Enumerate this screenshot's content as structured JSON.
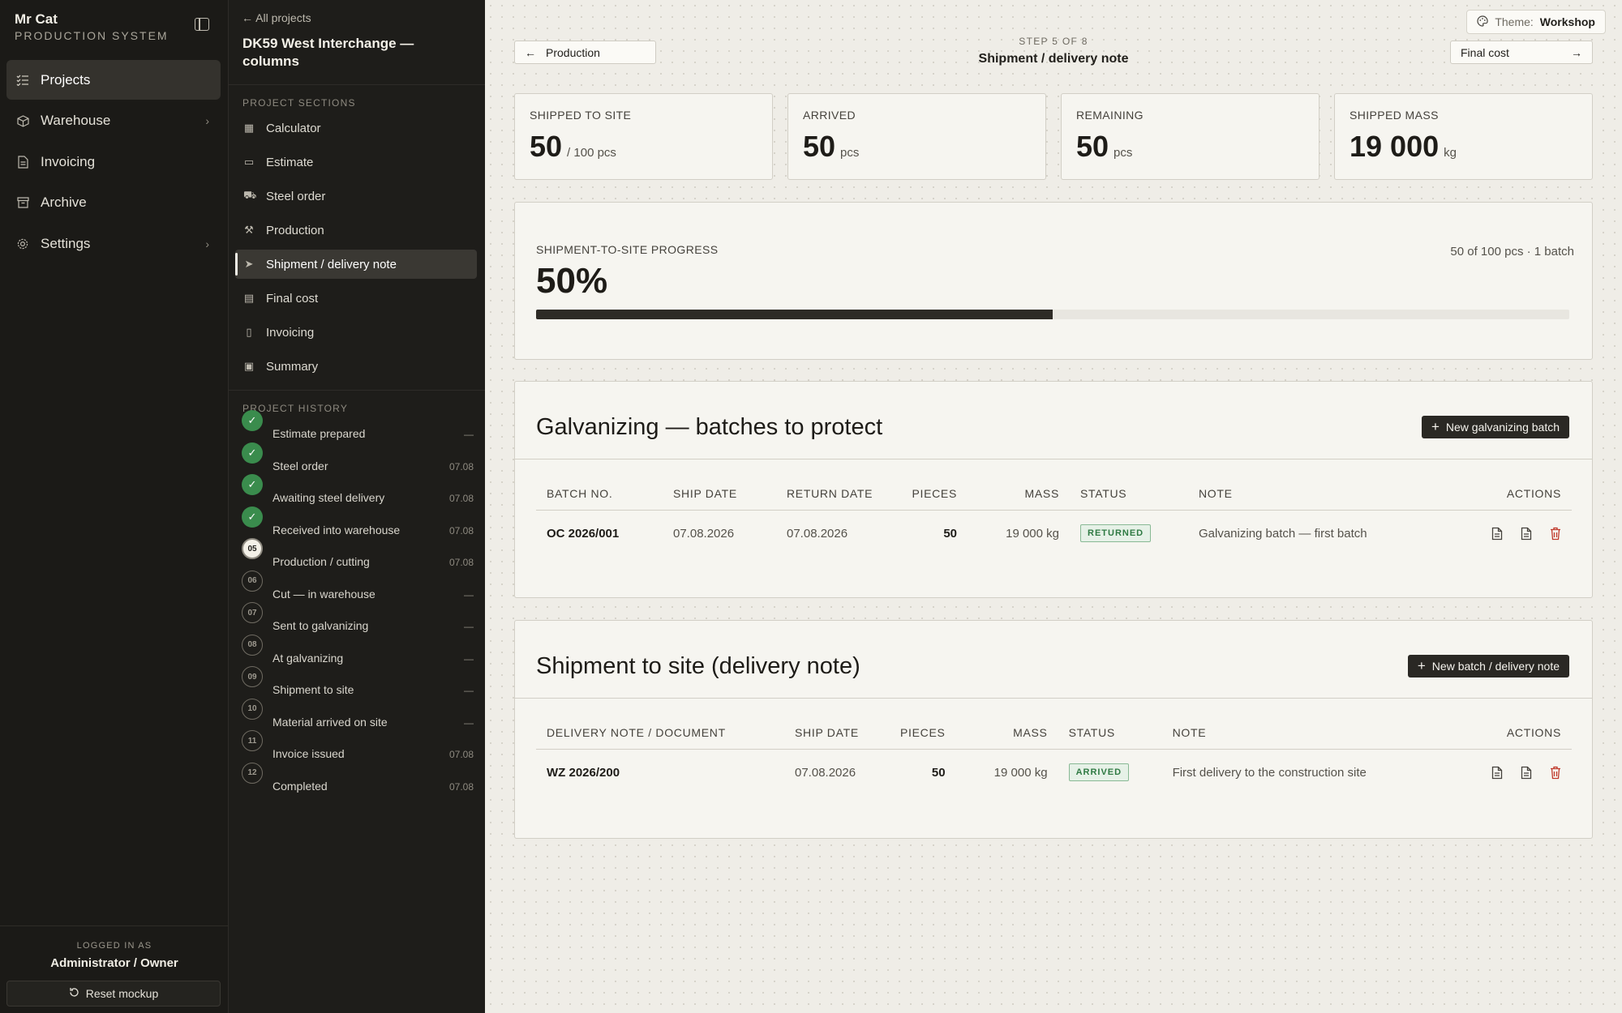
{
  "sidebar": {
    "brand_name": "Mr Cat",
    "brand_sub": "PRODUCTION SYSTEM",
    "items": [
      {
        "label": "Projects",
        "icon": "list-check-icon",
        "active": true
      },
      {
        "label": "Warehouse",
        "icon": "box-icon",
        "chevron": true
      },
      {
        "label": "Invoicing",
        "icon": "document-icon"
      },
      {
        "label": "Archive",
        "icon": "archive-icon"
      },
      {
        "label": "Settings",
        "icon": "gear-icon",
        "chevron": true
      }
    ],
    "logged_label": "LOGGED IN AS",
    "logged_user": "Administrator / Owner",
    "reset_label": "Reset mockup"
  },
  "project": {
    "back_label": "All projects",
    "title": "DK59 West Interchange — columns",
    "sections_label": "PROJECT SECTIONS",
    "sections": [
      {
        "label": "Calculator",
        "icon": "calculator-icon"
      },
      {
        "label": "Estimate",
        "icon": "wallet-icon"
      },
      {
        "label": "Steel order",
        "icon": "cart-icon"
      },
      {
        "label": "Production",
        "icon": "hammer-icon"
      },
      {
        "label": "Shipment / delivery note",
        "icon": "send-icon",
        "active": true
      },
      {
        "label": "Final cost",
        "icon": "receipt-icon"
      },
      {
        "label": "Invoicing",
        "icon": "document-icon"
      },
      {
        "label": "Summary",
        "icon": "clipboard-icon"
      }
    ],
    "history_label": "PROJECT HISTORY",
    "history": [
      {
        "badge": "✓",
        "state": "done",
        "name": "Estimate prepared",
        "date": "—"
      },
      {
        "badge": "✓",
        "state": "done",
        "name": "Steel order",
        "date": "07.08"
      },
      {
        "badge": "✓",
        "state": "done",
        "name": "Awaiting steel delivery",
        "date": "07.08"
      },
      {
        "badge": "✓",
        "state": "done",
        "name": "Received into warehouse",
        "date": "07.08"
      },
      {
        "badge": "05",
        "state": "current",
        "name": "Production / cutting",
        "date": "07.08"
      },
      {
        "badge": "06",
        "state": "todo",
        "name": "Cut — in warehouse",
        "date": "—"
      },
      {
        "badge": "07",
        "state": "todo",
        "name": "Sent to galvanizing",
        "date": "—"
      },
      {
        "badge": "08",
        "state": "todo",
        "name": "At galvanizing",
        "date": "—"
      },
      {
        "badge": "09",
        "state": "todo",
        "name": "Shipment to site",
        "date": "—"
      },
      {
        "badge": "10",
        "state": "todo",
        "name": "Material arrived on site",
        "date": "—"
      },
      {
        "badge": "11",
        "state": "todo",
        "name": "Invoice issued",
        "date": "07.08"
      },
      {
        "badge": "12",
        "state": "todo",
        "name": "Completed",
        "date": "07.08"
      }
    ]
  },
  "main": {
    "theme_label": "Theme:",
    "theme_value": "Workshop",
    "prev_step": "Production",
    "next_step": "Final cost",
    "step_count": "STEP 5 OF 8",
    "step_name": "Shipment / delivery note",
    "stats": [
      {
        "label": "SHIPPED TO SITE",
        "value": "50",
        "unit": "/ 100 pcs"
      },
      {
        "label": "ARRIVED",
        "value": "50",
        "unit": "pcs"
      },
      {
        "label": "REMAINING",
        "value": "50",
        "unit": "pcs"
      },
      {
        "label": "SHIPPED MASS",
        "value": "19 000",
        "unit": "kg"
      }
    ],
    "progress": {
      "label": "SHIPMENT-TO-SITE PROGRESS",
      "percent_text": "50%",
      "fraction": 0.5,
      "info": "50 of 100 pcs · 1 batch"
    },
    "galvanizing": {
      "title": "Galvanizing — batches to protect",
      "button": "New galvanizing batch",
      "headers": [
        "BATCH NO.",
        "SHIP DATE",
        "RETURN DATE",
        "PIECES",
        "MASS",
        "STATUS",
        "NOTE",
        "ACTIONS"
      ],
      "rows": [
        {
          "batch": "OC 2026/001",
          "ship_date": "07.08.2026",
          "return_date": "07.08.2026",
          "pieces": "50",
          "mass": "19 000 kg",
          "status": "RETURNED",
          "note": "Galvanizing batch — first batch"
        }
      ]
    },
    "shipment": {
      "title": "Shipment to site (delivery note)",
      "button": "New batch / delivery note",
      "headers": [
        "DELIVERY NOTE / DOCUMENT",
        "SHIP DATE",
        "PIECES",
        "MASS",
        "STATUS",
        "NOTE",
        "ACTIONS"
      ],
      "rows": [
        {
          "doc": "WZ 2026/200",
          "ship_date": "07.08.2026",
          "pieces": "50",
          "mass": "19 000 kg",
          "status": "ARRIVED",
          "note": "First delivery to the construction site"
        }
      ]
    },
    "colors": {
      "accent_dark": "#2a2824",
      "success": "#2f7a43",
      "danger": "#c0392b"
    }
  }
}
